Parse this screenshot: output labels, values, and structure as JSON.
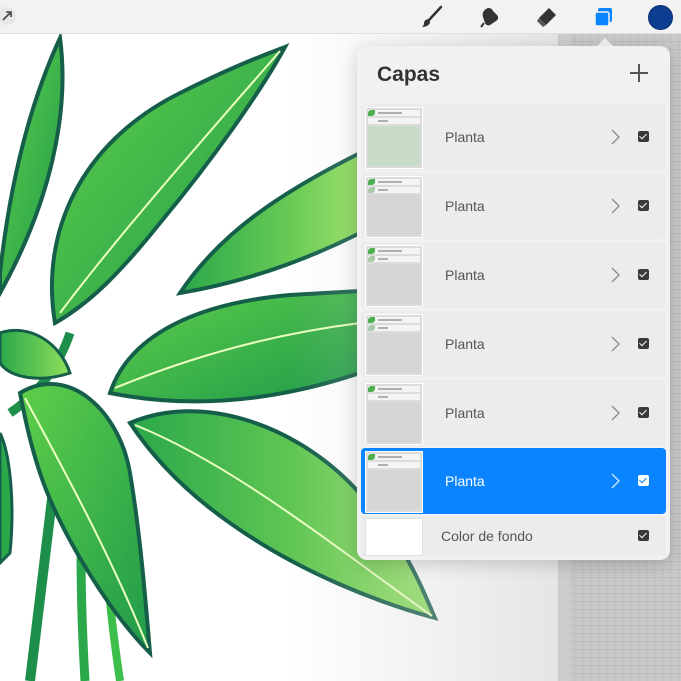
{
  "toolbar": {
    "tools": [
      {
        "icon": "brush-icon"
      },
      {
        "icon": "smudge-icon"
      },
      {
        "icon": "eraser-icon"
      },
      {
        "icon": "layers-icon",
        "active": true
      }
    ],
    "back_icon": "diagonal-arrow-icon",
    "current_color": "#0d3d91",
    "active_color": "#0a84ff"
  },
  "layers_panel": {
    "title": "Capas",
    "add_icon": "plus-icon",
    "layers": [
      {
        "name": "Planta",
        "visible": true,
        "selected": false
      },
      {
        "name": "Planta",
        "visible": true,
        "selected": false
      },
      {
        "name": "Planta",
        "visible": true,
        "selected": false
      },
      {
        "name": "Planta",
        "visible": true,
        "selected": false
      },
      {
        "name": "Planta",
        "visible": true,
        "selected": false
      },
      {
        "name": "Planta",
        "visible": true,
        "selected": true
      }
    ],
    "background_layer": {
      "name": "Color de fondo",
      "visible": true
    }
  }
}
